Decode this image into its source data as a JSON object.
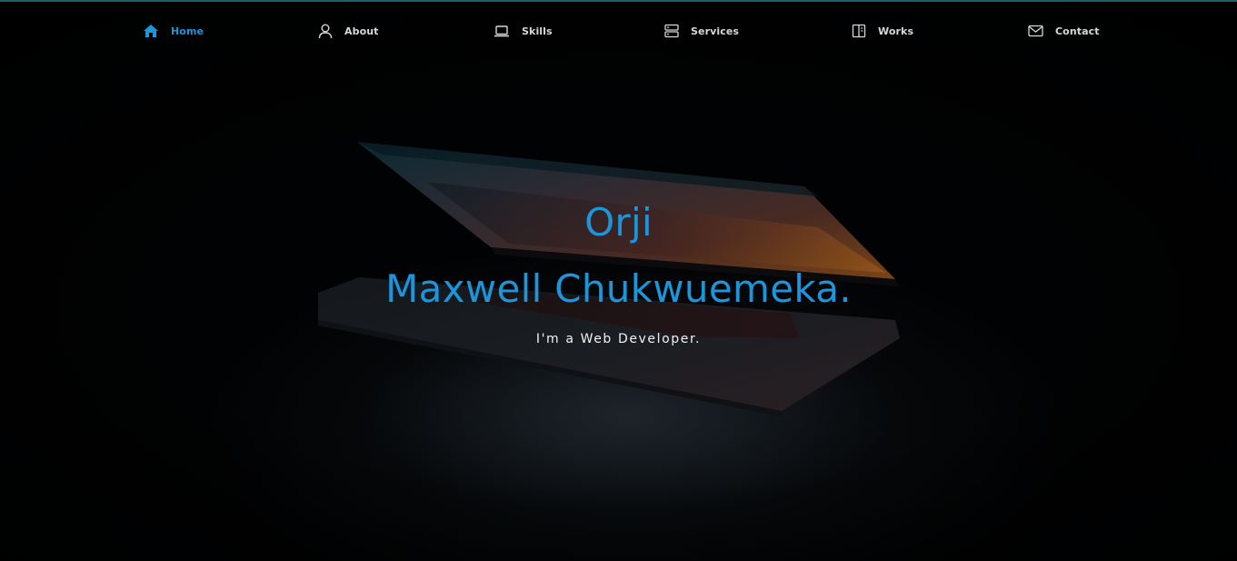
{
  "nav": {
    "items": [
      {
        "label": "Home",
        "icon": "home-icon",
        "active": true
      },
      {
        "label": "About",
        "icon": "user-icon",
        "active": false
      },
      {
        "label": "Skills",
        "icon": "laptop-icon",
        "active": false
      },
      {
        "label": "Services",
        "icon": "server-icon",
        "active": false
      },
      {
        "label": "Works",
        "icon": "book-icon",
        "active": false
      },
      {
        "label": "Contact",
        "icon": "mail-icon",
        "active": false
      }
    ]
  },
  "hero": {
    "name_first": "Orji",
    "name_last": "Maxwell Chukwuemeka.",
    "tagline": "I'm a Web Developer."
  },
  "colors": {
    "accent": "#1d95db",
    "nav_text": "#d8d8d8",
    "background": "#000000",
    "tagline": "#f2f2f2"
  }
}
